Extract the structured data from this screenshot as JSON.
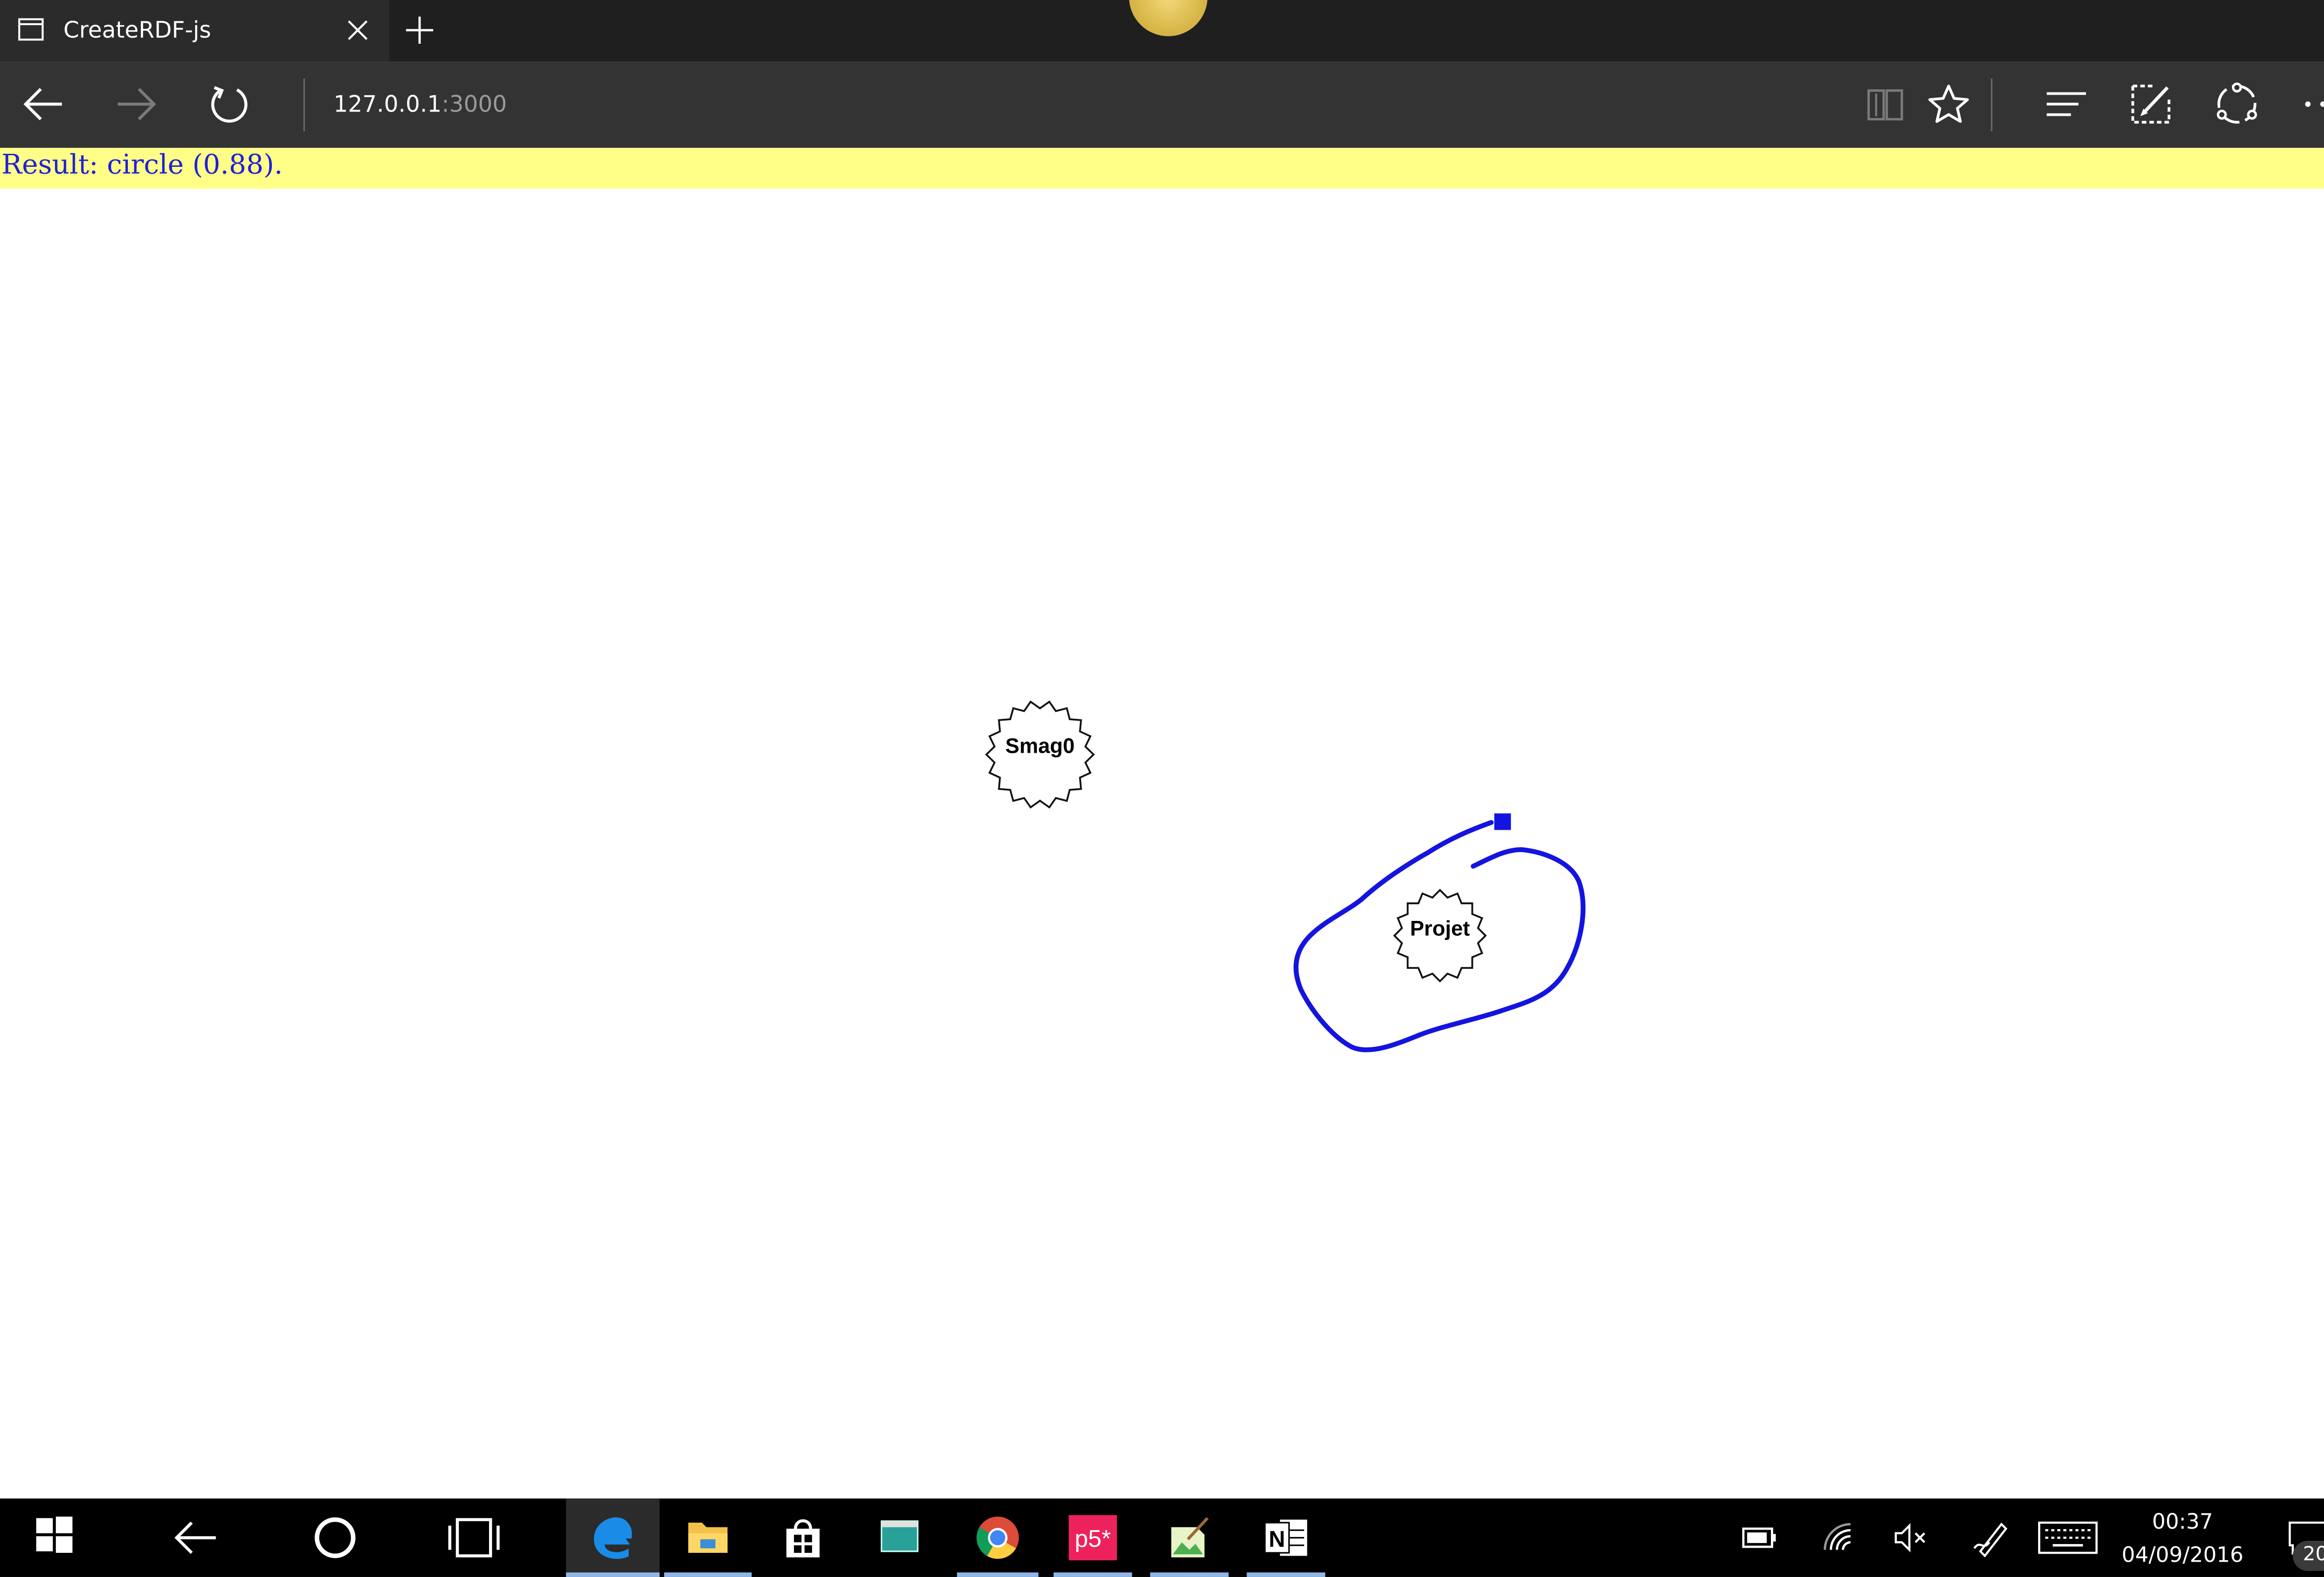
{
  "browser": {
    "tab": {
      "title": "CreateRDF-js",
      "favicon": "page-icon"
    },
    "address": {
      "host": "127.0.0.1",
      "port": ":3000"
    },
    "toolbar_icons": [
      "back-icon",
      "forward-icon",
      "refresh-icon",
      "reading-view-icon",
      "favorite-star-icon",
      "hub-icon",
      "web-note-icon",
      "share-icon",
      "more-icon"
    ]
  },
  "page": {
    "result": "Result: circle (0.88).",
    "result_bar_color": "#ffff88",
    "result_text_color": "#2020d8",
    "nodes": [
      {
        "label": "Smag0"
      },
      {
        "label": "Projet"
      }
    ],
    "stroke_color": "#1414e0"
  },
  "taskbar": {
    "items": [
      "start-icon",
      "back-icon",
      "cortana-icon",
      "task-view-icon",
      "edge-icon",
      "file-explorer-icon",
      "store-icon",
      "terminal-icon",
      "chrome-icon",
      "p5-icon",
      "image-editor-icon",
      "onenote-icon"
    ],
    "p5_label": "p5*",
    "tray": [
      "battery-icon",
      "wifi-icon",
      "volume-muted-icon",
      "pen-icon",
      "keyboard-icon"
    ],
    "time": "00:37",
    "date": "04/09/2016",
    "notifications": "20"
  }
}
